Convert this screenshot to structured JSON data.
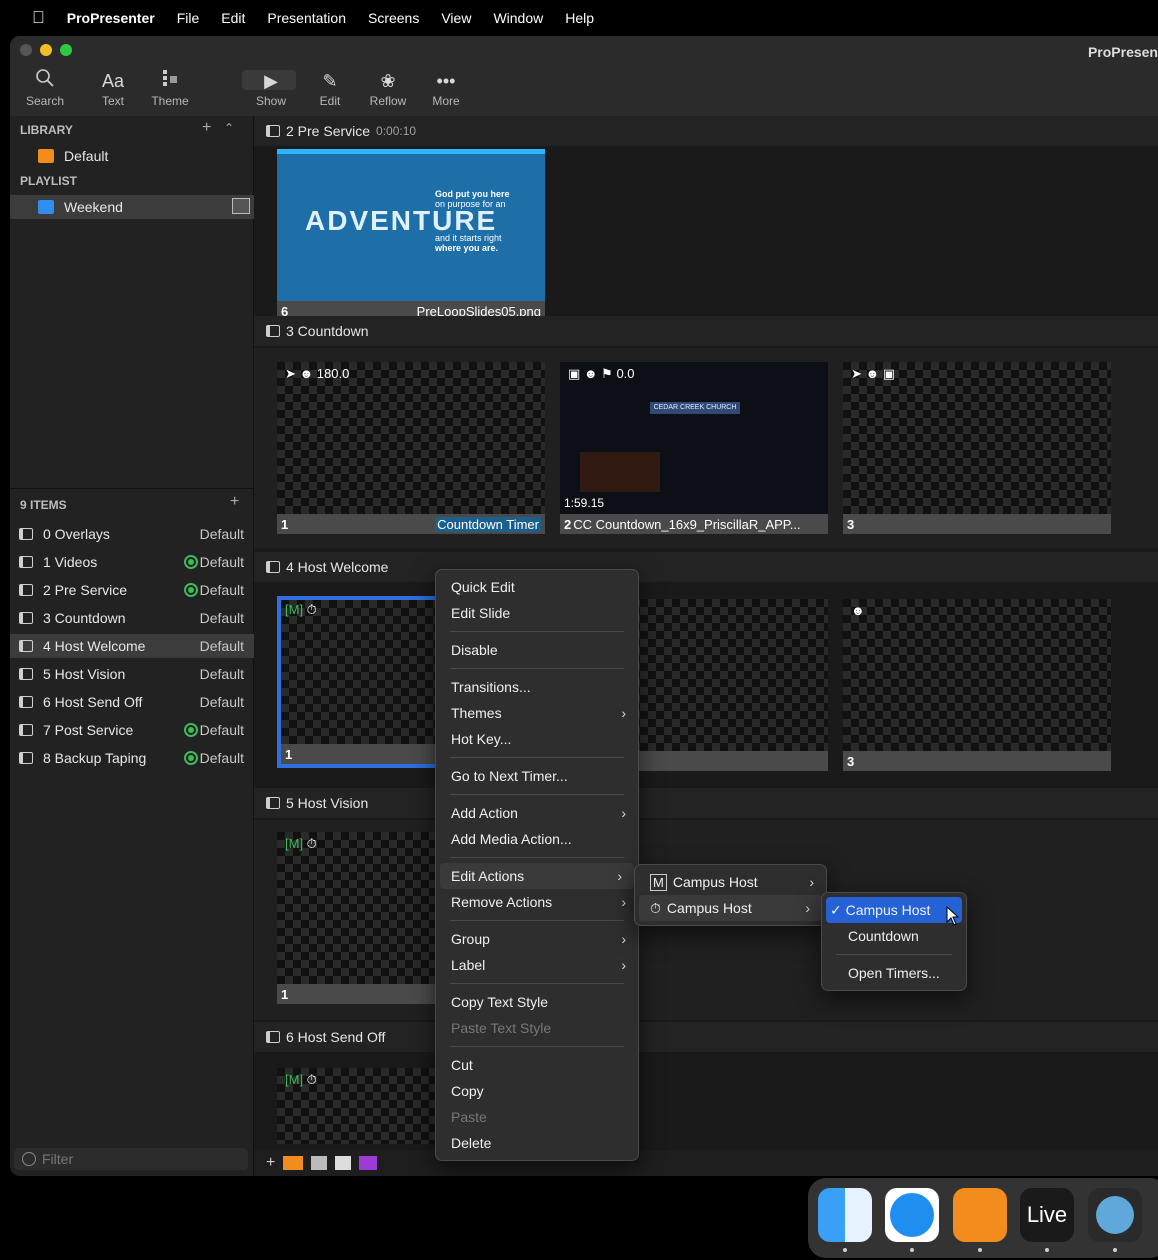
{
  "menubar": {
    "app": "ProPresenter",
    "items": [
      "File",
      "Edit",
      "Presentation",
      "Screens",
      "View",
      "Window",
      "Help"
    ]
  },
  "window": {
    "title": "ProPresen"
  },
  "toolbar": {
    "search": "Search",
    "text": "Text",
    "text_glyph": "Aa",
    "theme": "Theme",
    "show": "Show",
    "edit": "Edit",
    "reflow": "Reflow",
    "more": "More"
  },
  "sidebar": {
    "library_label": "LIBRARY",
    "library_items": [
      "Default"
    ],
    "playlist_label": "PLAYLIST",
    "playlist_items": [
      "Weekend"
    ],
    "count_label": "9 ITEMS",
    "items": [
      {
        "label": "0 Overlays",
        "theme": "Default"
      },
      {
        "label": "1 Videos",
        "theme": "Default"
      },
      {
        "label": "2 Pre Service",
        "theme": "Default"
      },
      {
        "label": "3 Countdown",
        "theme": "Default"
      },
      {
        "label": "4 Host Welcome",
        "theme": "Default"
      },
      {
        "label": "5 Host Vision",
        "theme": "Default"
      },
      {
        "label": "6 Host Send Off",
        "theme": "Default"
      },
      {
        "label": "7 Post Service",
        "theme": "Default"
      },
      {
        "label": "8 Backup Taping",
        "theme": "Default"
      }
    ],
    "filter_placeholder": "Filter"
  },
  "groups": {
    "g1": {
      "title": "2 Pre Service",
      "time": "0:00:10"
    },
    "g2": {
      "title": "3 Countdown"
    },
    "g3": {
      "title": "4 Host Welcome"
    },
    "g4": {
      "title": "5 Host Vision"
    },
    "g5": {
      "title": "6 Host Send Off"
    }
  },
  "slides": {
    "pre": {
      "num": "6",
      "name": "PreLoopSlides05.png",
      "art_big": "ADVENTURE",
      "art_text1": "God put you here",
      "art_text2": "on purpose for an",
      "art_text3": "and it starts right",
      "art_text4": "where you are."
    },
    "cd1": {
      "num": "1",
      "name": "Countdown Timer",
      "topline": "180.0"
    },
    "cd2": {
      "num": "2",
      "name": "CC Countdown_16x9_PriscillaR_APP...",
      "topline": "0.0",
      "overlay": "1:59.15",
      "sign": "CEDAR CREEK CHURCH"
    },
    "cd3": {
      "num": "3"
    },
    "hw1": {
      "num": "1"
    },
    "hw3": {
      "num": "3"
    },
    "hv1": {
      "num": "1"
    }
  },
  "context_menu": {
    "items": [
      "Quick Edit",
      "Edit Slide",
      "Disable",
      "Transitions...",
      "Themes",
      "Hot Key...",
      "Go to Next Timer...",
      "Add Action",
      "Add Media Action...",
      "Edit Actions",
      "Remove Actions",
      "Group",
      "Label",
      "Copy Text Style",
      "Paste Text Style",
      "Cut",
      "Copy",
      "Paste",
      "Delete"
    ]
  },
  "submenu1": {
    "items": [
      "Campus Host",
      "Campus Host"
    ],
    "badge": "M"
  },
  "submenu2": {
    "items": [
      "Campus Host",
      "Countdown",
      "Open Timers..."
    ],
    "check": "✓"
  },
  "dock": {
    "live": "Live"
  },
  "colors": {
    "accent": "#2462d6",
    "selection": "#2f6fe0",
    "sync_green": "#3dbb5a"
  }
}
